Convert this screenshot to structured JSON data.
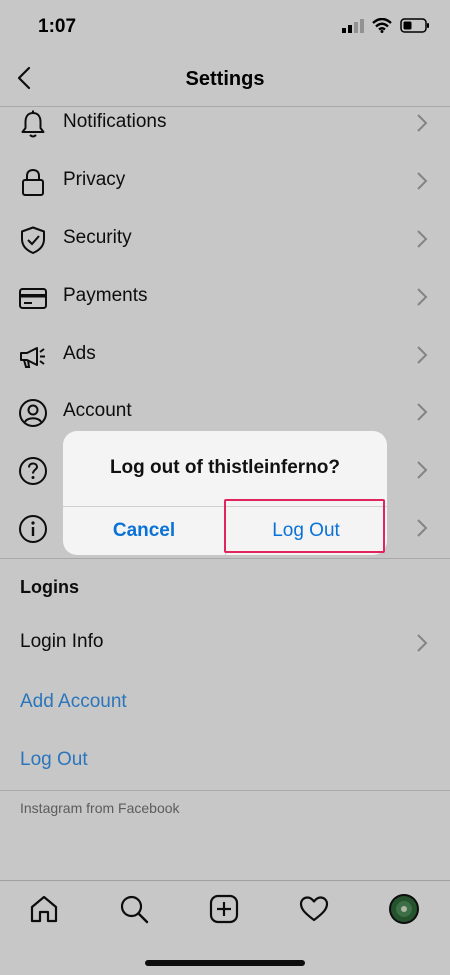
{
  "status_bar": {
    "time": "1:07"
  },
  "header": {
    "title": "Settings"
  },
  "menu": [
    {
      "label": "Notifications",
      "icon": "bell-icon"
    },
    {
      "label": "Privacy",
      "icon": "lock-icon"
    },
    {
      "label": "Security",
      "icon": "shield-icon"
    },
    {
      "label": "Payments",
      "icon": "card-icon"
    },
    {
      "label": "Ads",
      "icon": "megaphone-icon"
    },
    {
      "label": "Account",
      "icon": "account-icon"
    },
    {
      "label": "",
      "icon": "help-icon"
    },
    {
      "label": "",
      "icon": "info-icon"
    }
  ],
  "logins": {
    "heading": "Logins",
    "login_info": "Login Info",
    "add_account": "Add Account",
    "log_out": "Log Out"
  },
  "footer": {
    "note": "Instagram from Facebook"
  },
  "dialog": {
    "title": "Log out of thistleinferno?",
    "cancel": "Cancel",
    "confirm": "Log Out"
  },
  "colors": {
    "link": "#3897f0",
    "dialog_button": "#0a72d6",
    "highlight": "#e0245e"
  },
  "tabs": [
    "home-icon",
    "search-icon",
    "new-post-icon",
    "heart-icon",
    "profile-avatar"
  ]
}
